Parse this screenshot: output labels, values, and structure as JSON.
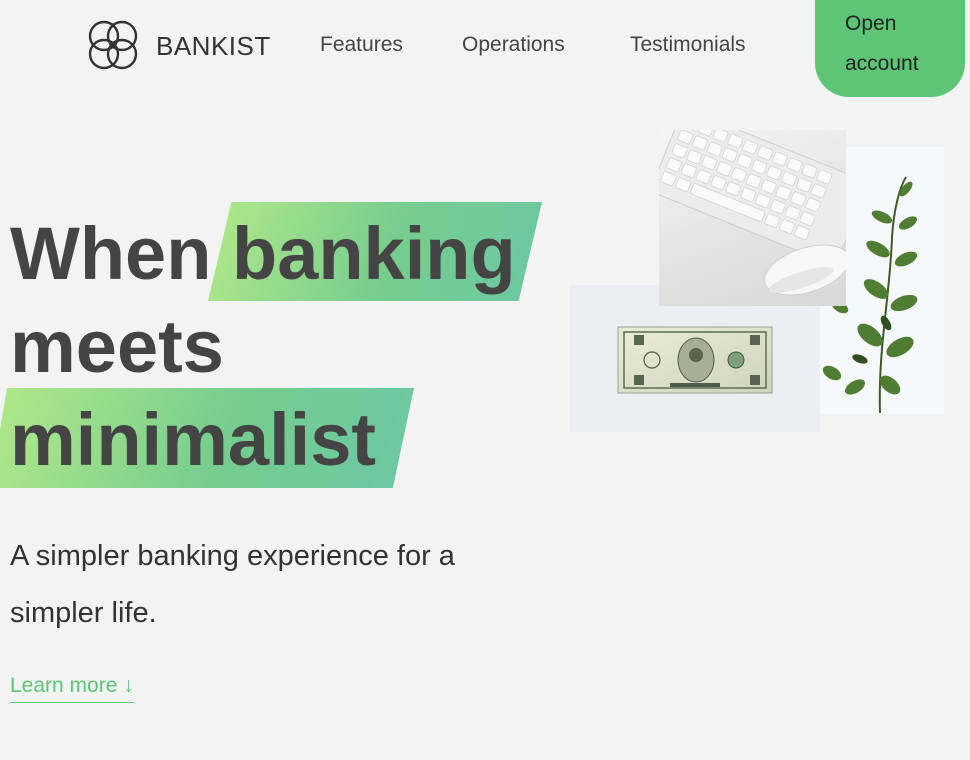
{
  "nav": {
    "logo_text": "BANKIST",
    "links": [
      "Features",
      "Operations",
      "Testimonials"
    ],
    "cta": [
      "Open",
      "account"
    ]
  },
  "hero": {
    "headline": [
      "When",
      "banking",
      "meets",
      "minimalist"
    ],
    "subtitle": "A simpler banking experience for a simpler life.",
    "learn_more": "Learn more ↓"
  },
  "colors": {
    "accent": "#5ec576",
    "text": "#444444",
    "background": "#f3f3f3"
  },
  "icons": [
    "bankist-logo-icon"
  ],
  "images": [
    "keyboard-photo",
    "dollar-bill-photo",
    "plant-photo"
  ]
}
